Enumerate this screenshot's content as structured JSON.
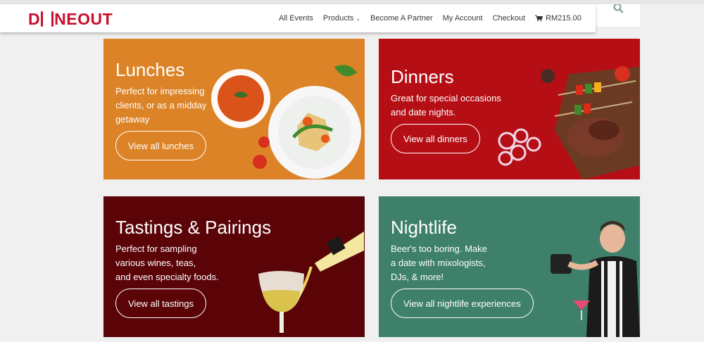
{
  "brand": {
    "logo_left": "D",
    "logo_right": "NEOUT",
    "logo_text": "DINEOUT",
    "color": "#c8102e"
  },
  "nav": {
    "items": [
      {
        "label": "All Events"
      },
      {
        "label": "Products"
      },
      {
        "label": "Become A Partner"
      },
      {
        "label": "My Account"
      },
      {
        "label": "Checkout"
      }
    ],
    "cart_total": "RM215.00",
    "cart_icon": "cart-icon",
    "dropdown_icon": "chevron-down-icon"
  },
  "search": {
    "icon": "search-icon"
  },
  "cards": [
    {
      "title": "Lunches",
      "desc": [
        "Perfect for impressing",
        "clients, or as a midday",
        "getaway"
      ],
      "button": "View all lunches",
      "bg": "#dc8327"
    },
    {
      "title": "Dinners",
      "desc": [
        "Great for special occasions",
        "and date nights."
      ],
      "button": "View all dinners",
      "bg": "#b50f15"
    },
    {
      "title": "Tastings & Pairings",
      "desc": [
        "Perfect for sampling",
        "various wines, teas,",
        "and even specialty foods."
      ],
      "button": "View all tastings",
      "bg": "#5a0407"
    },
    {
      "title": "Nightlife",
      "desc": [
        "Beer's too boring. Make",
        "a date with mixologists,",
        "DJs, & more!"
      ],
      "button": "View all nightlife experiences",
      "bg": "#3e8069"
    }
  ]
}
